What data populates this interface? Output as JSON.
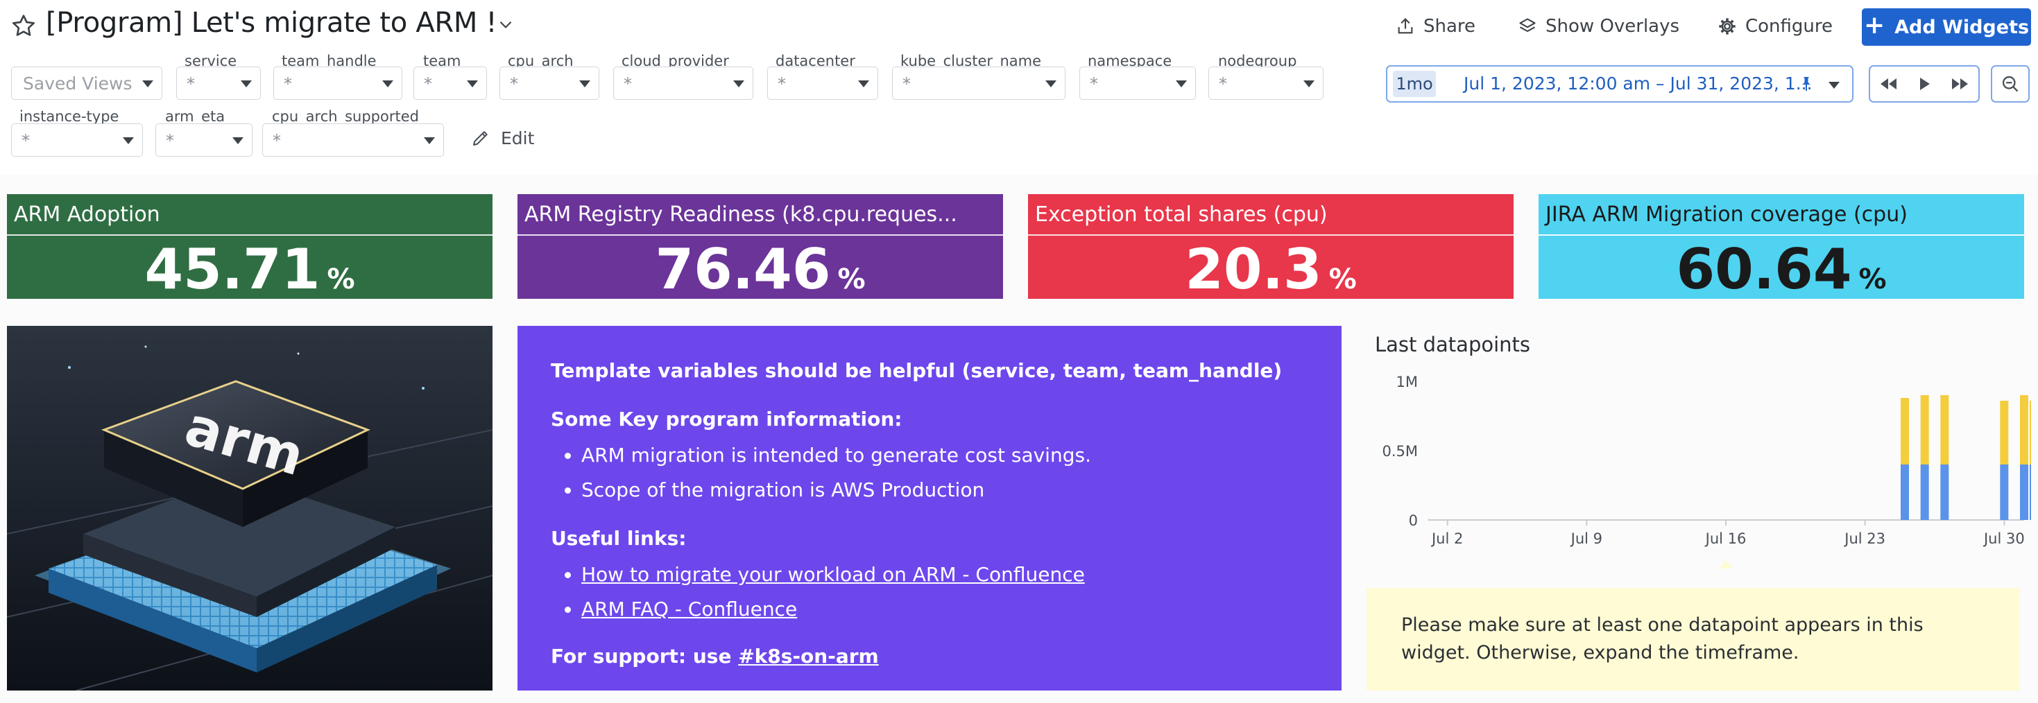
{
  "header": {
    "title": "[Program] Let's migrate to ARM !",
    "share_label": "Share",
    "overlays_label": "Show Overlays",
    "configure_label": "Configure",
    "add_widgets_label": "Add Widgets"
  },
  "template_vars": {
    "saved_views": "Saved Views",
    "edit_label": "Edit",
    "vars": [
      {
        "label": "service",
        "value": "*"
      },
      {
        "label": "team_handle",
        "value": "*"
      },
      {
        "label": "team",
        "value": "*"
      },
      {
        "label": "cpu_arch",
        "value": "*"
      },
      {
        "label": "cloud_provider",
        "value": "*"
      },
      {
        "label": "datacenter",
        "value": "*"
      },
      {
        "label": "kube_cluster_name",
        "value": "*"
      },
      {
        "label": "namespace",
        "value": "*"
      },
      {
        "label": "nodegroup",
        "value": "*"
      },
      {
        "label": "instance-type",
        "value": "*"
      },
      {
        "label": "arm_eta",
        "value": "*"
      },
      {
        "label": "cpu_arch_supported",
        "value": "*"
      }
    ]
  },
  "time": {
    "span": "1mo",
    "range": "Jul 1, 2023, 12:00 am – Jul 31, 2023, 1..."
  },
  "widgets": {
    "qv": [
      {
        "title": "ARM Adoption",
        "value": "45.71",
        "unit": "%",
        "bg": "#2f6e43",
        "fg": "#ffffff"
      },
      {
        "title": "ARM Registry Readiness (k8.cpu.reques...",
        "value": "76.46",
        "unit": "%",
        "bg": "#6b3499",
        "fg": "#ffffff"
      },
      {
        "title": "Exception total shares (cpu)",
        "value": "20.3",
        "unit": "%",
        "bg": "#e8364a",
        "fg": "#ffffff"
      },
      {
        "title": "JIRA ARM Migration coverage (cpu)",
        "value": "60.64",
        "unit": "%",
        "bg": "#4fd3f0",
        "fg": "#1a1a1a"
      }
    ],
    "image_logo_text": "arm",
    "note": {
      "heading": "Template variables should be helpful (service, team, team_handle)",
      "key_info_heading": "Some Key program information:",
      "key_info": [
        "ARM migration is intended to generate cost savings.",
        "Scope of the migration is AWS Production"
      ],
      "links_heading": "Useful links:",
      "links": [
        "How to migrate your workload on ARM - Confluence",
        "ARM FAQ - Confluence"
      ],
      "support_prefix": "For support: use",
      "support_link": "#k8s-on-arm"
    },
    "chart_title": "Last datapoints",
    "warning": "Please make sure at least one datapoint appears in this widget. Otherwise, expand the timeframe."
  },
  "chart_data": {
    "type": "bar",
    "title": "Last datapoints",
    "stacked": true,
    "x_ticks": [
      "Jul 2",
      "Jul 9",
      "Jul 16",
      "Jul 23",
      "Jul 30"
    ],
    "y_ticks": [
      "0",
      "0.5M",
      "1M"
    ],
    "ylim": [
      0,
      1000000
    ],
    "xlim": [
      "Jul 1",
      "Jul 31"
    ],
    "categories": [
      "Jul 25",
      "Jul 26",
      "Jul 27",
      "Jul 30",
      "Jul 31"
    ],
    "series": [
      {
        "values": [
          400000,
          400000,
          400000,
          400000,
          400000
        ],
        "color": "#5a93e9"
      },
      {
        "values": [
          480000,
          500000,
          500000,
          460000,
          500000
        ],
        "color": "#f4cd3c"
      }
    ],
    "extra_bar": {
      "x": "Jul 31",
      "lower": 400000,
      "upper": 460000
    },
    "grid": false
  }
}
